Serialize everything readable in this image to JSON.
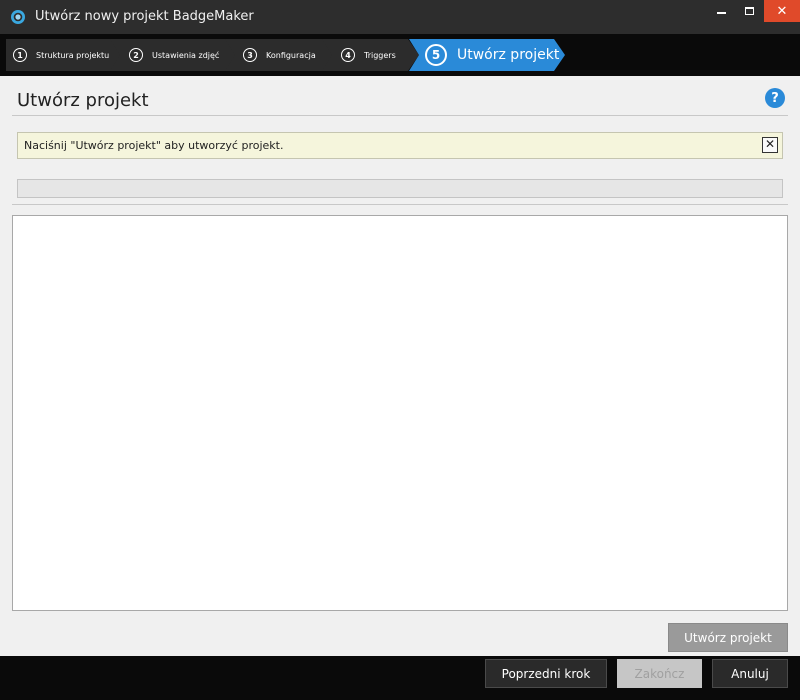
{
  "window": {
    "title": "Utwórz nowy projekt BadgeMaker",
    "close_glyph": "✕"
  },
  "steps": [
    {
      "number": "1",
      "label": "Struktura projektu",
      "active": false
    },
    {
      "number": "2",
      "label": "Ustawienia zdjęć",
      "active": false
    },
    {
      "number": "3",
      "label": "Konfiguracja",
      "active": false
    },
    {
      "number": "4",
      "label": "Triggers",
      "active": false
    },
    {
      "number": "5",
      "label": "Utwórz projekt",
      "active": true
    }
  ],
  "page": {
    "title": "Utwórz projekt",
    "help_glyph": "?"
  },
  "info": {
    "message": "Naciśnij \"Utwórz projekt\" aby utworzyć projekt.",
    "close_glyph": "✕"
  },
  "progress": {
    "value": 0
  },
  "log": {
    "content": ""
  },
  "actions": {
    "create_label": "Utwórz projekt"
  },
  "footer": {
    "prev_label": "Poprzedni krok",
    "finish_label": "Zakończ",
    "cancel_label": "Anuluj"
  },
  "colors": {
    "accent": "#2a8ad8",
    "step_inactive": "#2c2c2c",
    "step_active": "#2a8ad8",
    "close_button": "#e04a2a"
  },
  "icons": {
    "app": "app-logo-icon",
    "minimize": "minimize-icon",
    "maximize": "maximize-icon",
    "close": "close-icon",
    "help": "help-icon"
  }
}
